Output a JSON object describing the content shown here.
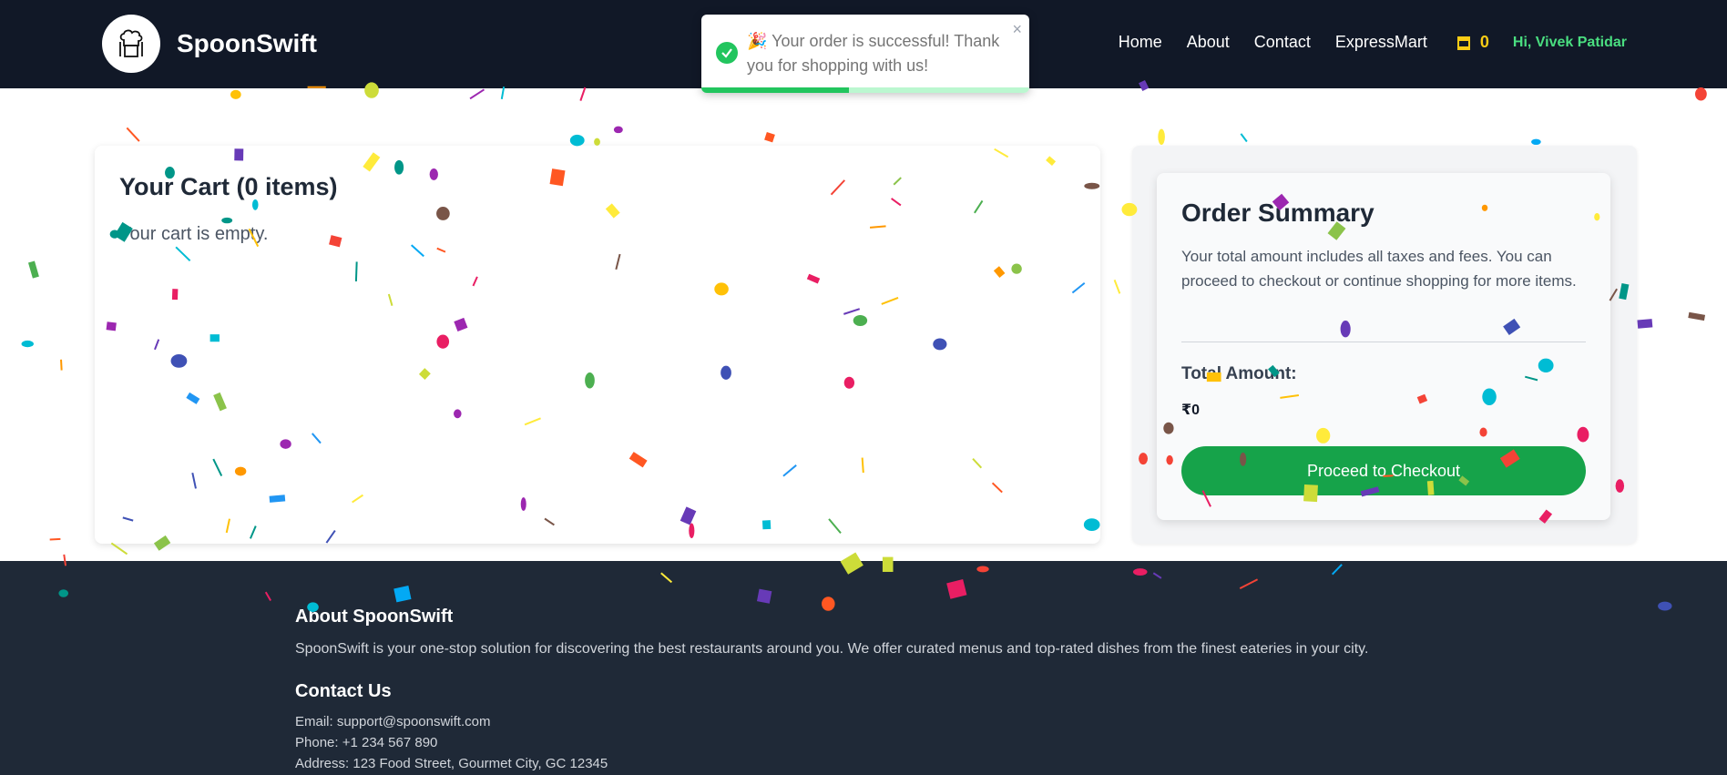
{
  "header": {
    "brand_name": "SpoonSwift",
    "nav": [
      "Home",
      "About",
      "Contact",
      "ExpressMart"
    ],
    "cart_count": "0",
    "greeting": "Hi, Vivek Patidar"
  },
  "toast": {
    "message": "Your order is successful! Thank you for shopping with us!",
    "emoji": "🎉",
    "close": "×",
    "progress": 0.45
  },
  "cart": {
    "title": "Your Cart (0 items)",
    "empty_text": "Your cart is empty."
  },
  "summary": {
    "title": "Order Summary",
    "description": "Your total amount includes all taxes and fees. You can proceed to checkout or continue shopping for more items.",
    "total_label": "Total Amount:",
    "total_value": "₹0",
    "checkout_label": "Proceed to Checkout"
  },
  "footer": {
    "about_title": "About SpoonSwift",
    "about_text": "SpoonSwift is your one-stop solution for discovering the best restaurants around you. We offer curated menus and top-rated dishes from the finest eateries in your city.",
    "contact_title": "Contact Us",
    "email": "Email: support@spoonswift.com",
    "phone": "Phone: +1 234 567 890",
    "address": "Address: 123 Food Street, Gourmet City, GC 12345"
  },
  "colors": {
    "header_bg": "#111827",
    "accent_green": "#16a34a",
    "cart_yellow": "#facc15",
    "greeting_green": "#4ade80",
    "footer_bg": "#1f2937"
  }
}
